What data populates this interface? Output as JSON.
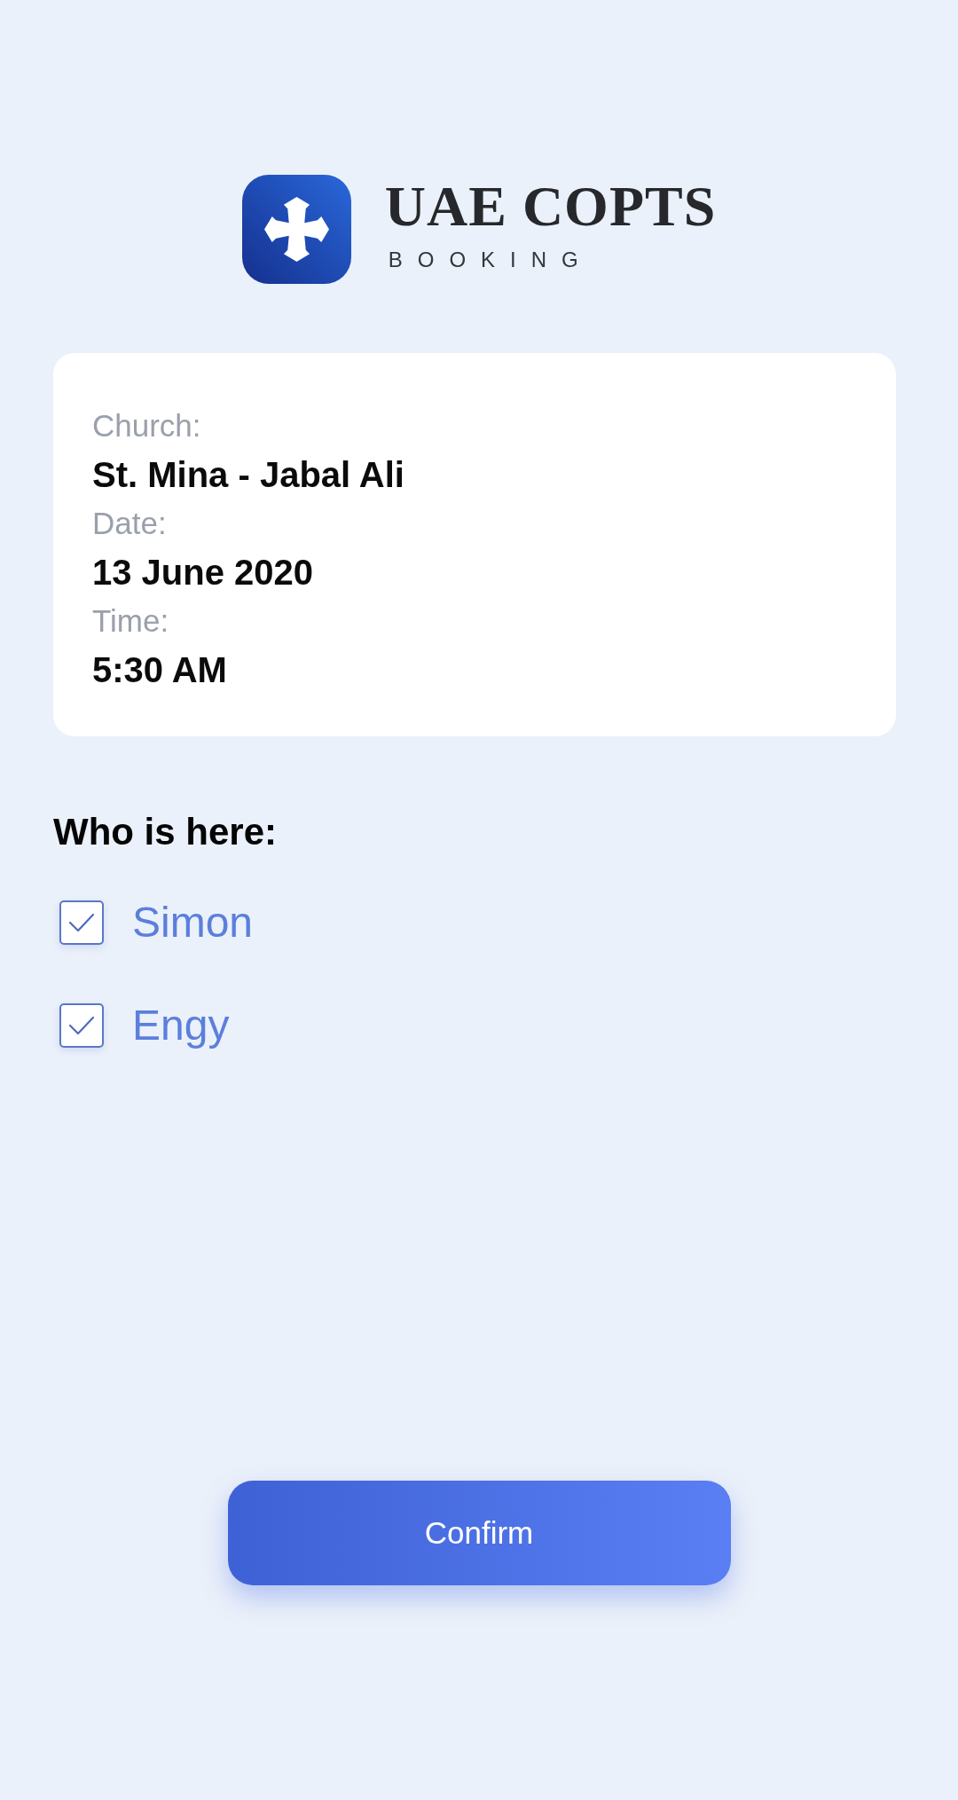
{
  "logo": {
    "title": "UAE COPTS",
    "subtitle": "BOOKING"
  },
  "booking": {
    "fields": [
      {
        "label": "Church:",
        "value": "St. Mina - Jabal Ali"
      },
      {
        "label": "Date:",
        "value": "13 June 2020"
      },
      {
        "label": "Time:",
        "value": "5:30 AM"
      }
    ]
  },
  "attendance": {
    "heading": "Who is here:",
    "people": [
      {
        "name": "Simon",
        "checked": true
      },
      {
        "name": "Engy",
        "checked": true
      }
    ]
  },
  "confirm_button": {
    "label": "Confirm"
  }
}
